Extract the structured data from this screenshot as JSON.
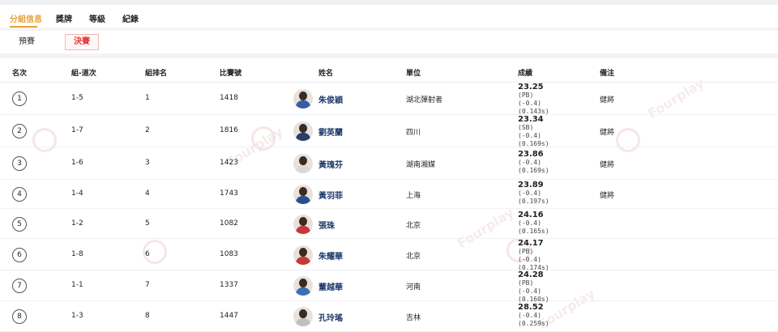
{
  "tabs": [
    {
      "label": "分組信息"
    },
    {
      "label": "獎牌"
    },
    {
      "label": "等級"
    },
    {
      "label": "紀錄"
    }
  ],
  "subtabs": [
    {
      "label": "預賽"
    },
    {
      "label": "決賽"
    }
  ],
  "watermark": "Fourplay",
  "columns": [
    "名次",
    "組-道次",
    "組排名",
    "比賽號",
    "姓名",
    "單位",
    "成績",
    "備注"
  ],
  "colors": {
    "accent": "#e8a33c",
    "active_sub": "#e53935",
    "name": "#1d3a6b"
  },
  "rows": [
    {
      "rank": "1",
      "lane": "1-5",
      "group_rank": "1",
      "bib": "1418",
      "name": "朱俊穎",
      "unit": "湖北彈射者",
      "time": "23.25",
      "extra": [
        "(PB)",
        "(-0.4)",
        "(0.143s)"
      ],
      "note": "健將",
      "avatar_color": "#3b5ba8"
    },
    {
      "rank": "2",
      "lane": "1-7",
      "group_rank": "2",
      "bib": "1816",
      "name": "劉英蘭",
      "unit": "四川",
      "time": "23.34",
      "extra": [
        "(SB)",
        "(-0.4)",
        "(0.169s)"
      ],
      "note": "健將",
      "avatar_color": "#2a3f66"
    },
    {
      "rank": "3",
      "lane": "1-6",
      "group_rank": "3",
      "bib": "1423",
      "name": "黃瑰芬",
      "unit": "湖南湘媒",
      "time": "23.86",
      "extra": [
        "(-0.4)",
        "(0.169s)"
      ],
      "note": "健將",
      "avatar_color": "#d9d9d9"
    },
    {
      "rank": "4",
      "lane": "1-4",
      "group_rank": "4",
      "bib": "1743",
      "name": "黃羽菲",
      "unit": "上海",
      "time": "23.89",
      "extra": [
        "(-0.4)",
        "(0.197s)"
      ],
      "note": "健將",
      "avatar_color": "#2c4e8a"
    },
    {
      "rank": "5",
      "lane": "1-2",
      "group_rank": "5",
      "bib": "1082",
      "name": "張珠",
      "unit": "北京",
      "time": "24.16",
      "extra": [
        "(-0.4)",
        "(0.165s)"
      ],
      "note": "",
      "avatar_color": "#c8373a"
    },
    {
      "rank": "6",
      "lane": "1-8",
      "group_rank": "6",
      "bib": "1083",
      "name": "朱耀華",
      "unit": "北京",
      "time": "24.17",
      "extra": [
        "(PB)",
        "(-0.4)",
        "(0.174s)"
      ],
      "note": "",
      "avatar_color": "#c8373a"
    },
    {
      "rank": "7",
      "lane": "1-1",
      "group_rank": "7",
      "bib": "1337",
      "name": "董越華",
      "unit": "河南",
      "time": "24.28",
      "extra": [
        "(PB)",
        "(-0.4)",
        "(0.160s)"
      ],
      "note": "",
      "avatar_color": "#3b6fb3"
    },
    {
      "rank": "8",
      "lane": "1-3",
      "group_rank": "8",
      "bib": "1447",
      "name": "孔玲瑤",
      "unit": "吉林",
      "time": "28.52",
      "extra": [
        "(-0.4)",
        "(0.259s)"
      ],
      "note": "",
      "avatar_color": "#bfbfbf"
    }
  ]
}
